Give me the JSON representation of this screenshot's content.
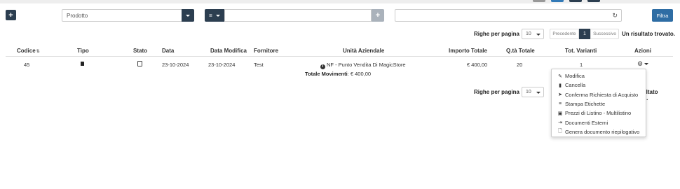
{
  "toolbar": {
    "add_label": "+",
    "product_select_value": "Prodotto",
    "operator_value": "=",
    "search_value": "",
    "filter_label": "Filtra"
  },
  "pagination_top": {
    "rows_label": "Righe per pagina",
    "rows_value": "10",
    "prev_label": "Precedente",
    "page": "1",
    "next_label": "Successivo",
    "result_text": "Un risultato trovato."
  },
  "table": {
    "headers": {
      "codice": "Codice",
      "tipo": "Tipo",
      "stato": "Stato",
      "data": "Data",
      "data_modifica": "Data Modifica",
      "fornitore": "Fornitore",
      "unita": "Unità Aziendale",
      "importo": "Importo Totale",
      "qta": "Q.tà Totale",
      "varianti": "Tot. Varianti",
      "azioni": "Azioni"
    },
    "row": {
      "codice": "45",
      "data": "23-10-2024",
      "data_modifica": "23-10-2024",
      "fornitore": "Test",
      "unita": "NF - Punto Vendita Di MagicStore",
      "importo": "€ 400,00",
      "qta": "20",
      "varianti": "1"
    },
    "totals_label": "Totale Movimenti",
    "totals_value": ": € 400,00"
  },
  "pagination_bottom": {
    "rows_label": "Righe per pagina",
    "rows_value": "10",
    "result_text": "un risultato trovato."
  },
  "actions_menu": {
    "items": [
      {
        "label": "Modifica",
        "icon": "pencil-icon"
      },
      {
        "label": "Cancella",
        "icon": "trash-icon"
      },
      {
        "label": "Conferma Richiesta di Acquisto",
        "icon": "send-icon"
      },
      {
        "label": "Stampa Etichette",
        "icon": "list-icon"
      },
      {
        "label": "Prezzi di Listino - Multilistino",
        "icon": "money-icon"
      },
      {
        "label": "Documenti Esterni",
        "icon": "sign-in-icon"
      },
      {
        "label": "Genera documento riepilogativo",
        "icon": "document-icon"
      }
    ]
  },
  "colors": {
    "primary_dark": "#2c3e50",
    "filter_button": "#2e6da4",
    "top_accent": "#337ab7"
  }
}
